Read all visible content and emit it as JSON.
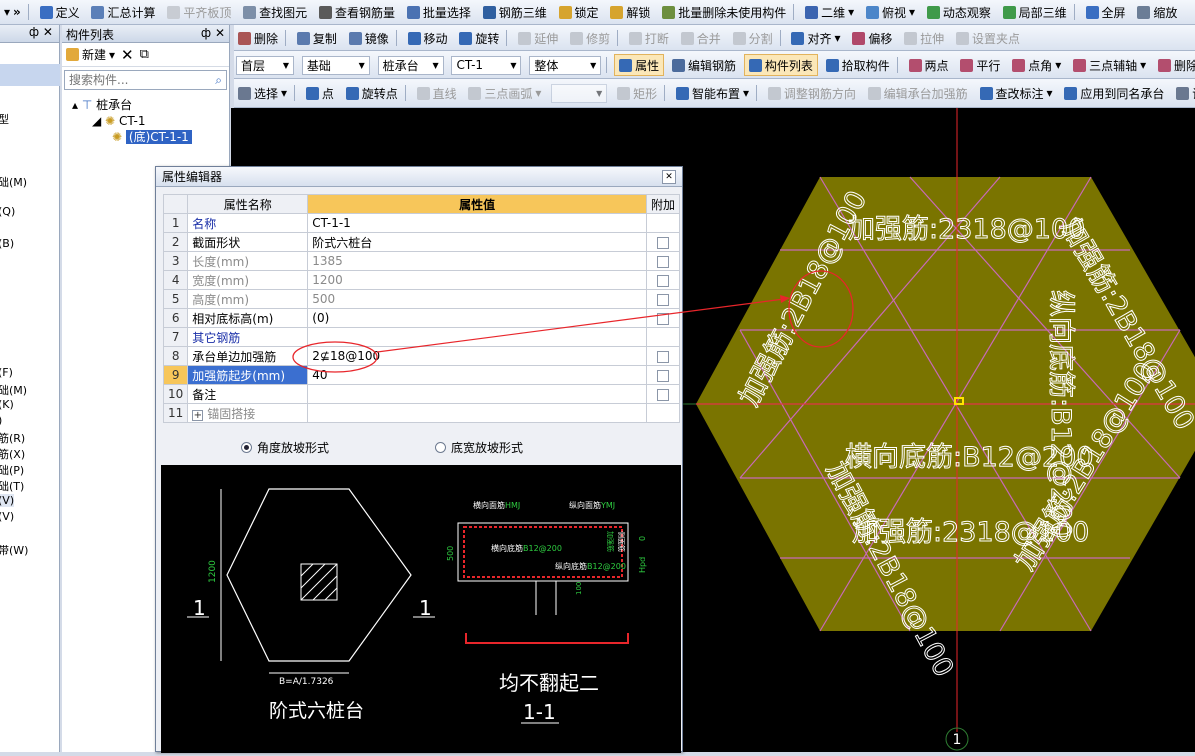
{
  "colors": {
    "pad": "#7a7400",
    "lines": "#c86ab7",
    "axis": "#e8262b",
    "dialogBlack": "#000000",
    "header": "#f7c65a"
  },
  "toolbar1": {
    "items": [
      "定义",
      "汇总计算",
      "平齐板顶",
      "查找图元",
      "查看钢筋量",
      "批量选择",
      "钢筋三维",
      "锁定",
      "解锁",
      "批量删除未使用构件",
      "二维",
      "俯视",
      "动态观察",
      "局部三维",
      "全屏",
      "缩放"
    ]
  },
  "toolbar2": {
    "items": [
      "删除",
      "复制",
      "镜像",
      "移动",
      "旋转",
      "延伸",
      "修剪",
      "打断",
      "合并",
      "分割",
      "对齐",
      "偏移",
      "拉伸",
      "设置夹点"
    ]
  },
  "toolbar3": {
    "floor": "首层",
    "type": "基础",
    "category": "桩承台",
    "component": "CT-1",
    "scope": "整体",
    "items": [
      "属性",
      "编辑钢筋",
      "构件列表",
      "拾取构件",
      "两点",
      "平行",
      "点角",
      "三点辅轴",
      "删除辅轴"
    ]
  },
  "toolbar4": {
    "items": [
      "选择",
      "点",
      "旋转点",
      "直线",
      "三点画弧",
      "矩形",
      "智能布置",
      "调整钢筋方向",
      "编辑承台加强筋",
      "查改标注",
      "应用到同名承台",
      "调"
    ]
  },
  "leftstrip": {
    "items": [
      "型",
      "础(M)",
      "(Q)",
      "(B)",
      "(F)",
      "础(M)",
      "(K)",
      ")",
      "筋(R)",
      "筋(X)",
      "础(P)",
      "础(T)",
      "(V)",
      "(V)",
      "带(W)"
    ]
  },
  "panel": {
    "title": "构件列表",
    "pin": "ф",
    "close": "✕",
    "new_label": "新建",
    "search_placeholder": "搜索构件...",
    "tree_root": "桩承台",
    "tree_child": "CT-1",
    "tree_leaf": "(底)CT-1-1"
  },
  "dialog": {
    "title": "属性编辑器",
    "close": "✕",
    "headers": {
      "name": "属性名称",
      "value": "属性值",
      "extra": "附加"
    },
    "rows": [
      {
        "n": "1",
        "name": "名称",
        "value": "CT-1-1",
        "style": "blue",
        "chk": false
      },
      {
        "n": "2",
        "name": "截面形状",
        "value": "阶式六桩台",
        "style": "",
        "chk": true
      },
      {
        "n": "3",
        "name": "长度(mm)",
        "value": "1385",
        "style": "gray",
        "chk": true
      },
      {
        "n": "4",
        "name": "宽度(mm)",
        "value": "1200",
        "style": "gray",
        "chk": true
      },
      {
        "n": "5",
        "name": "高度(mm)",
        "value": "500",
        "style": "gray",
        "chk": true
      },
      {
        "n": "6",
        "name": "相对底标高(m)",
        "value": "(0)",
        "style": "",
        "chk": true
      },
      {
        "n": "7",
        "name": "其它钢筋",
        "value": "",
        "style": "blue",
        "chk": false
      },
      {
        "n": "8",
        "name": "承台单边加强筋",
        "value": "2⊈18@100",
        "style": "",
        "chk": true
      },
      {
        "n": "9",
        "name": "加强筋起步(mm)",
        "value": "40",
        "style": "sel",
        "chk": true
      },
      {
        "n": "10",
        "name": "备注",
        "value": "",
        "style": "",
        "chk": true
      },
      {
        "n": "11",
        "name": "锚固搭接",
        "value": "",
        "style": "gray",
        "chk": false
      }
    ],
    "radio1": "角度放坡形式",
    "radio2": "底宽放坡形式",
    "diagram": {
      "dim1200": "1200",
      "dimB": "B=A/1.7326",
      "mark1": "1",
      "mark2": "1",
      "caption": "阶式六桩台",
      "sec_top": "横向面筋",
      "sec_top_code": "HMJ",
      "sec_side": "纵向面筋",
      "sec_side_code": "YMJ",
      "sec_bot1": "横向底筋",
      "sec_bot1_code": "B12@200",
      "sec_bot2": "纵向底筋",
      "sec_bot2_code": "B12@200",
      "sec_vert": "侧面筋",
      "sec_vert2": "加强筋",
      "dim500": "500",
      "dim100": "100",
      "dim0": "0",
      "dimHpd": "Hpd",
      "sec_title": "均不翻起二",
      "sec_label": "1-1"
    }
  },
  "canvas": {
    "top_text": "加强筋:2318@100",
    "bottom_text": "加强筋:2318@100",
    "left_upper": "加强筋:2B18@100",
    "left_lower": "加强筋:2B18@100",
    "right_upper": "加强筋:2B18@100",
    "right_lower": "加强筋:2B18@100",
    "right_vert": "纵向底筋:B12@200",
    "center": "横向底筋:B12@200",
    "axis_label": "1"
  }
}
